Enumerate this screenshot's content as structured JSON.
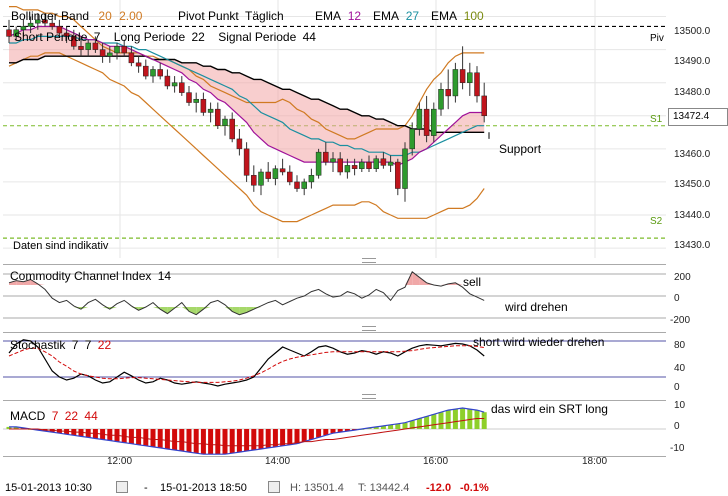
{
  "legend": {
    "bollinger": "Bollinger Band",
    "bb_p1": "20",
    "bb_p2": "2.00",
    "pivot": "Pivot Punkt",
    "pivot_period": "Täglich",
    "ema_label": "EMA",
    "ema1": "12",
    "ema2": "27",
    "ema3": "100",
    "short": "Short Periode",
    "short_v": "7",
    "long": "Long Periode",
    "long_v": "22",
    "signal": "Signal Periode",
    "signal_v": "44",
    "indicative": "Daten sind indikativ"
  },
  "colors": {
    "bb": "#d07a22",
    "ema12": "#a0129a",
    "ema27": "#1a8fa0",
    "ema100": "#7a8a10",
    "up": "#2e9b2e",
    "down": "#c0141c",
    "pivot_green": "#7cbb2a",
    "macd_green": "#8ecf2a",
    "macd_red": "#d20a0a"
  },
  "price_axis": {
    "ticks": [
      "13500.0",
      "13490.0",
      "13480.0",
      "13472.4",
      "13460.0",
      "13450.0",
      "13440.0",
      "13430.0"
    ],
    "levels": {
      "piv": "Piv",
      "s1": "S1",
      "s2": "S2"
    },
    "current": "13472.4"
  },
  "annotations": {
    "support": "Support",
    "sell": "sell",
    "wird_drehen": "wird drehen",
    "short_drehen": "short wird wieder drehen",
    "srt_long": "das wird ein SRT long"
  },
  "cci": {
    "title": "Commodity Channel Index",
    "period": "14",
    "ticks": [
      "200",
      "0",
      "-200"
    ]
  },
  "stoch": {
    "title": "Stochastik",
    "p1": "7",
    "p2": "7",
    "p3": "22",
    "ticks": [
      "80",
      "40",
      "0"
    ]
  },
  "macd": {
    "title": "MACD",
    "p1": "7",
    "p2": "22",
    "p3": "44",
    "ticks": [
      "10",
      "0",
      "-10"
    ]
  },
  "time_axis": [
    "12:00",
    "14:00",
    "16:00",
    "18:00"
  ],
  "footer": {
    "from": "15-01-2013 10:30",
    "sep": "-",
    "to": "15-01-2013 18:50",
    "high": "H: 13501.4",
    "low": "T: 13442.4",
    "change": "-12.0",
    "change_pct": "-0.1%"
  },
  "chart_data": {
    "type": "candlestick",
    "x_start": "10:30",
    "x_end": "18:50",
    "interval_minutes": 5,
    "ylim": [
      13427,
      13505
    ],
    "levels": {
      "pivot": 13497,
      "s1": 13467,
      "s2": 13433
    },
    "candles": [
      [
        13496,
        13499,
        13492,
        13494
      ],
      [
        13494,
        13497,
        13493,
        13496
      ],
      [
        13496,
        13499,
        13494,
        13497
      ],
      [
        13497,
        13500,
        13495,
        13498
      ],
      [
        13498,
        13501,
        13496,
        13499
      ],
      [
        13499,
        13501,
        13497,
        13498
      ],
      [
        13498,
        13500,
        13496,
        13497
      ],
      [
        13497,
        13499,
        13494,
        13495
      ],
      [
        13495,
        13497,
        13492,
        13494
      ],
      [
        13494,
        13496,
        13490,
        13491
      ],
      [
        13491,
        13494,
        13488,
        13490
      ],
      [
        13490,
        13493,
        13488,
        13492
      ],
      [
        13492,
        13494,
        13489,
        13490
      ],
      [
        13490,
        13492,
        13486,
        13488
      ],
      [
        13488,
        13491,
        13486,
        13489
      ],
      [
        13489,
        13492,
        13487,
        13491
      ],
      [
        13491,
        13493,
        13488,
        13489
      ],
      [
        13489,
        13491,
        13485,
        13486
      ],
      [
        13486,
        13488,
        13483,
        13485
      ],
      [
        13485,
        13487,
        13481,
        13482
      ],
      [
        13482,
        13485,
        13480,
        13484
      ],
      [
        13484,
        13486,
        13481,
        13482
      ],
      [
        13482,
        13484,
        13478,
        13479
      ],
      [
        13479,
        13482,
        13477,
        13480
      ],
      [
        13480,
        13482,
        13476,
        13477
      ],
      [
        13477,
        13479,
        13473,
        13474
      ],
      [
        13474,
        13477,
        13471,
        13475
      ],
      [
        13475,
        13477,
        13470,
        13471
      ],
      [
        13471,
        13474,
        13468,
        13472
      ],
      [
        13472,
        13474,
        13466,
        13467
      ],
      [
        13467,
        13470,
        13464,
        13469
      ],
      [
        13469,
        13471,
        13462,
        13463
      ],
      [
        13463,
        13466,
        13458,
        13460
      ],
      [
        13460,
        13462,
        13450,
        13452
      ],
      [
        13452,
        13455,
        13447,
        13449
      ],
      [
        13449,
        13454,
        13446,
        13453
      ],
      [
        13453,
        13456,
        13450,
        13451
      ],
      [
        13451,
        13455,
        13449,
        13454
      ],
      [
        13454,
        13457,
        13452,
        13453
      ],
      [
        13453,
        13455,
        13449,
        13450
      ],
      [
        13450,
        13452,
        13447,
        13448
      ],
      [
        13448,
        13451,
        13446,
        13450
      ],
      [
        13450,
        13454,
        13448,
        13452
      ],
      [
        13452,
        13460,
        13451,
        13459
      ],
      [
        13459,
        13462,
        13455,
        13456
      ],
      [
        13456,
        13459,
        13453,
        13457
      ],
      [
        13457,
        13459,
        13452,
        13453
      ],
      [
        13453,
        13457,
        13451,
        13455
      ],
      [
        13455,
        13457,
        13452,
        13454
      ],
      [
        13454,
        13457,
        13453,
        13456
      ],
      [
        13456,
        13458,
        13453,
        13454
      ],
      [
        13454,
        13458,
        13453,
        13457
      ],
      [
        13457,
        13459,
        13454,
        13455
      ],
      [
        13455,
        13458,
        13453,
        13456
      ],
      [
        13456,
        13457,
        13446,
        13448
      ],
      [
        13448,
        13462,
        13444,
        13460
      ],
      [
        13460,
        13468,
        13458,
        13466
      ],
      [
        13466,
        13474,
        13464,
        13472
      ],
      [
        13472,
        13476,
        13462,
        13464
      ],
      [
        13464,
        13474,
        13462,
        13472
      ],
      [
        13472,
        13480,
        13470,
        13478
      ],
      [
        13478,
        13484,
        13472,
        13476
      ],
      [
        13476,
        13486,
        13474,
        13484
      ],
      [
        13484,
        13491,
        13478,
        13480
      ],
      [
        13480,
        13486,
        13476,
        13483
      ],
      [
        13483,
        13485,
        13474,
        13476
      ],
      [
        13476,
        13480,
        13468,
        13470
      ]
    ],
    "bb_upper": [
      13503,
      13503,
      13502,
      13502,
      13502,
      13501,
      13501,
      13500,
      13500,
      13499,
      13497,
      13495,
      13493,
      13491,
      13490,
      13489,
      13489,
      13489,
      13489,
      13488,
      13488,
      13487,
      13487,
      13486,
      13485,
      13484,
      13482,
      13481,
      13479,
      13478,
      13477,
      13476,
      13475,
      13474,
      13474,
      13474,
      13474,
      13474,
      13475,
      13474,
      13472,
      13471,
      13469,
      13468,
      13466,
      13465,
      13464,
      13463,
      13463,
      13464,
      13465,
      13466,
      13466,
      13466,
      13466,
      13467,
      13470,
      13474,
      13478,
      13481,
      13483,
      13486,
      13488,
      13489,
      13489,
      13489,
      13489
    ],
    "bb_lower": [
      13485,
      13486,
      13487,
      13488,
      13488,
      13489,
      13489,
      13489,
      13488,
      13487,
      13486,
      13485,
      13484,
      13483,
      13481,
      13480,
      13479,
      13477,
      13476,
      13474,
      13472,
      13470,
      13468,
      13466,
      13464,
      13462,
      13460,
      13458,
      13456,
      13454,
      13452,
      13450,
      13448,
      13446,
      13443,
      13441,
      13440,
      13439,
      13438,
      13438,
      13438,
      13439,
      13440,
      13441,
      13442,
      13443,
      13443,
      13443,
      13443,
      13444,
      13444,
      13443,
      13441,
      13440,
      13439,
      13439,
      13439,
      13439,
      13439,
      13440,
      13441,
      13442,
      13442,
      13442,
      13443,
      13445,
      13448
    ],
    "ema12": [
      13494,
      13495,
      13496,
      13496,
      13497,
      13497,
      13497,
      13497,
      13496,
      13495,
      13494,
      13493,
      13493,
      13492,
      13491,
      13491,
      13491,
      13490,
      13489,
      13488,
      13487,
      13486,
      13485,
      13484,
      13483,
      13481,
      13480,
      13478,
      13477,
      13475,
      13474,
      13472,
      13470,
      13468,
      13465,
      13463,
      13461,
      13460,
      13459,
      13458,
      13457,
      13456,
      13456,
      13456,
      13456,
      13456,
      13456,
      13456,
      13456,
      13456,
      13456,
      13456,
      13456,
      13456,
      13455,
      13456,
      13457,
      13459,
      13460,
      13462,
      13464,
      13466,
      13468,
      13470,
      13471,
      13471,
      13471
    ],
    "ema27": [
      13492,
      13492,
      13493,
      13493,
      13494,
      13494,
      13494,
      13494,
      13494,
      13494,
      13493,
      13493,
      13493,
      13492,
      13492,
      13492,
      13491,
      13491,
      13490,
      13490,
      13489,
      13488,
      13487,
      13486,
      13485,
      13484,
      13483,
      13482,
      13481,
      13480,
      13479,
      13478,
      13476,
      13475,
      13473,
      13471,
      13470,
      13469,
      13468,
      13466,
      13465,
      13464,
      13463,
      13463,
      13462,
      13462,
      13461,
      13461,
      13460,
      13460,
      13459,
      13459,
      13459,
      13458,
      13458,
      13458,
      13459,
      13459,
      13460,
      13461,
      13462,
      13463,
      13464,
      13465,
      13466,
      13467,
      13467
    ],
    "ema100": [
      13486,
      13486,
      13487,
      13487,
      13487,
      13488,
      13488,
      13488,
      13488,
      13488,
      13488,
      13488,
      13488,
      13488,
      13488,
      13488,
      13488,
      13488,
      13488,
      13488,
      13487,
      13487,
      13487,
      13487,
      13486,
      13486,
      13486,
      13485,
      13485,
      13484,
      13484,
      13483,
      13483,
      13482,
      13481,
      13481,
      13480,
      13479,
      13478,
      13478,
      13477,
      13476,
      13475,
      13475,
      13474,
      13473,
      13472,
      13472,
      13471,
      13470,
      13470,
      13469,
      13469,
      13468,
      13467,
      13467,
      13466,
      13466,
      13466,
      13465,
      13465,
      13465,
      13465,
      13465,
      13465,
      13465,
      13465
    ],
    "cci": [
      120,
      140,
      130,
      150,
      110,
      60,
      -20,
      -60,
      -40,
      -90,
      -120,
      -60,
      -30,
      -80,
      -120,
      -70,
      -40,
      -90,
      -130,
      -100,
      -60,
      -120,
      -160,
      -110,
      -60,
      -140,
      -170,
      -120,
      -60,
      -40,
      -80,
      -140,
      -170,
      -150,
      -120,
      -90,
      -60,
      -40,
      -80,
      -50,
      -20,
      0,
      40,
      60,
      20,
      -10,
      0,
      40,
      20,
      -20,
      10,
      60,
      30,
      -40,
      50,
      80,
      220,
      170,
      120,
      100,
      90,
      110,
      120,
      80,
      20,
      -10,
      -40
    ],
    "stoch_k": [
      60,
      75,
      82,
      80,
      70,
      50,
      30,
      20,
      15,
      18,
      25,
      22,
      15,
      10,
      12,
      20,
      28,
      22,
      15,
      10,
      12,
      18,
      15,
      10,
      8,
      10,
      12,
      10,
      8,
      5,
      8,
      10,
      12,
      15,
      20,
      35,
      50,
      60,
      70,
      65,
      60,
      55,
      62,
      70,
      72,
      68,
      62,
      58,
      60,
      64,
      62,
      58,
      62,
      60,
      55,
      62,
      68,
      72,
      74,
      73,
      72,
      74,
      76,
      75,
      72,
      65,
      55
    ],
    "stoch_d": [
      55,
      60,
      65,
      68,
      68,
      62,
      55,
      45,
      38,
      30,
      25,
      22,
      20,
      18,
      17,
      17,
      18,
      19,
      19,
      18,
      17,
      16,
      15,
      14,
      13,
      12,
      11,
      11,
      11,
      11,
      12,
      13,
      15,
      18,
      22,
      27,
      33,
      40,
      46,
      50,
      53,
      55,
      57,
      59,
      61,
      62,
      62,
      62,
      62,
      62,
      62,
      62,
      62,
      62,
      62,
      63,
      64,
      66,
      68,
      69,
      70,
      71,
      72,
      72,
      72,
      71,
      69
    ],
    "macd": [
      1,
      1,
      0.5,
      0,
      -0.5,
      -1,
      -1.5,
      -2,
      -2.5,
      -3,
      -3.5,
      -4,
      -4.5,
      -5,
      -5.5,
      -6,
      -6.5,
      -7,
      -7.5,
      -8,
      -8.5,
      -9,
      -9.5,
      -10,
      -10.5,
      -11,
      -11.5,
      -12,
      -12,
      -12,
      -12,
      -11.5,
      -11,
      -10.5,
      -10,
      -9.5,
      -9,
      -8.5,
      -8,
      -7.5,
      -7,
      -6,
      -5,
      -4,
      -3,
      -2,
      -1.5,
      -1,
      -0.5,
      0,
      0.5,
      1,
      1.5,
      2,
      2.5,
      3,
      4,
      5,
      6,
      7,
      8,
      9,
      9.5,
      10,
      9.5,
      9,
      8
    ],
    "macd_signal": [
      0,
      0,
      0,
      0,
      0,
      -0.5,
      -0.5,
      -1,
      -1,
      -1.5,
      -1.5,
      -2,
      -2,
      -2.5,
      -3,
      -3,
      -3.5,
      -4,
      -4,
      -4.5,
      -5,
      -5,
      -5.5,
      -6,
      -6,
      -6.5,
      -7,
      -7,
      -7.5,
      -7.5,
      -8,
      -8,
      -8,
      -8,
      -8,
      -8,
      -7.5,
      -7.5,
      -7,
      -7,
      -6.5,
      -6,
      -6,
      -5.5,
      -5,
      -5,
      -4.5,
      -4,
      -3.5,
      -3,
      -2.5,
      -2,
      -1.5,
      -1,
      -0.5,
      0,
      0.5,
      1,
      1.5,
      2,
      2.5,
      3,
      3.5,
      4,
      4.5,
      5,
      5
    ]
  }
}
